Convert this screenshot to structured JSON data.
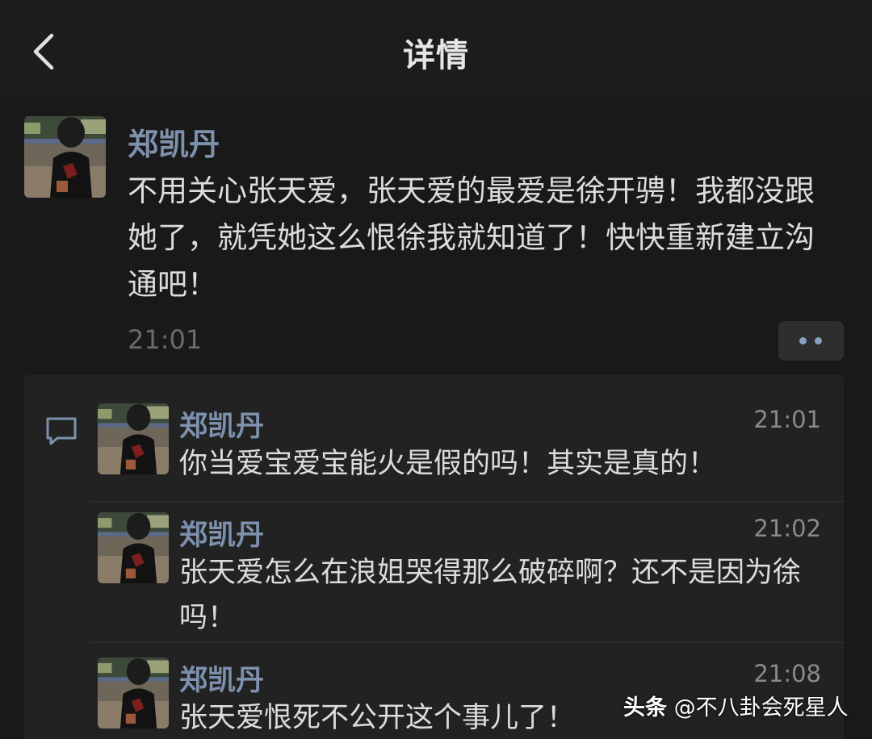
{
  "nav": {
    "title": "详情",
    "back_icon": "chevron-left-icon"
  },
  "post": {
    "author": "郑凯丹",
    "text": "不用关心张天爱，张天爱的最爱是徐开骋！我都没跟她了，就凭她这么恨徐我就知道了！快快重新建立沟通吧！",
    "time": "21:01",
    "more_icon": "more-dots-icon"
  },
  "comments": [
    {
      "author": "郑凯丹",
      "time": "21:01",
      "text": "你当爱宝爱宝能火是假的吗！其实是真的！"
    },
    {
      "author": "郑凯丹",
      "time": "21:02",
      "text": "张天爱怎么在浪姐哭得那么破碎啊？还不是因为徐吗！"
    },
    {
      "author": "郑凯丹",
      "time": "21:08",
      "text": "张天爱恨死不公开这个事儿了！"
    }
  ],
  "watermark": {
    "brand": "头条",
    "handle": "@不八卦会死星人"
  },
  "colors": {
    "background": "#191919",
    "name_accent": "#7d90ad",
    "text": "#dcdcdc"
  }
}
